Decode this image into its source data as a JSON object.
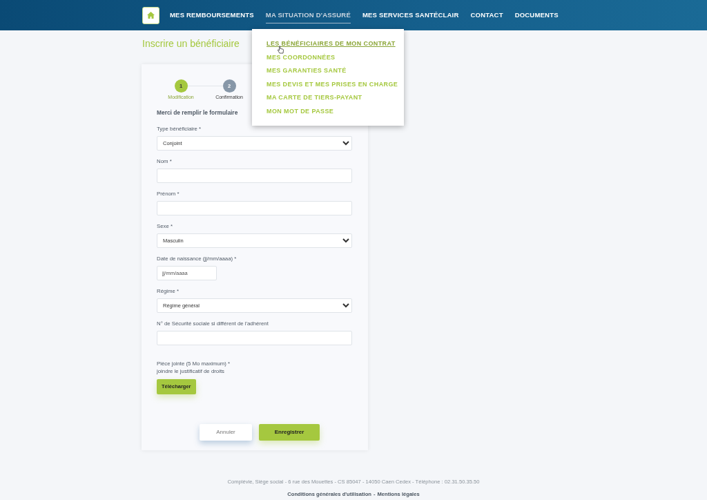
{
  "nav": {
    "items": [
      {
        "label": "MES REMBOURSEMENTS",
        "selected": false
      },
      {
        "label": "MA SITUATION D'ASSURÉ",
        "selected": true
      },
      {
        "label": "MES SERVICES SANTÉCLAIR",
        "selected": false
      },
      {
        "label": "CONTACT",
        "selected": false
      },
      {
        "label": "DOCUMENTS",
        "selected": false
      }
    ]
  },
  "dropdown": {
    "items": [
      {
        "label": "LES BÉNÉFICIAIRES DE MON CONTRAT",
        "selected": true
      },
      {
        "label": "MES COORDONNÉES",
        "selected": false
      },
      {
        "label": "MES GARANTIES SANTÉ",
        "selected": false
      },
      {
        "label": "MES DEVIS ET MES PRISES EN CHARGE",
        "selected": false
      },
      {
        "label": "MA CARTE DE TIERS-PAYANT",
        "selected": false
      },
      {
        "label": "MON MOT DE PASSE",
        "selected": false
      }
    ]
  },
  "page_title": "Inscrire un bénéficiaire",
  "stepper": [
    {
      "number": "1",
      "label": "Modification",
      "selected": true
    },
    {
      "number": "2",
      "label": "Confirmation",
      "selected": false
    }
  ],
  "form": {
    "intro": "Merci de remplir le formulaire",
    "fields": [
      {
        "kind": "select",
        "label": "Type bénéficiaire *",
        "value": "Conjoint"
      },
      {
        "kind": "text",
        "label": "Nom *"
      },
      {
        "kind": "text",
        "label": "Prénom *"
      },
      {
        "kind": "select",
        "label": "Sexe *",
        "value": "Masculin"
      },
      {
        "kind": "date",
        "label": "Date de naissance (jj/mm/aaaa) *",
        "placeholder": "jj/mm/aaaa"
      },
      {
        "kind": "select",
        "label": "Régime *",
        "value": "Régime général"
      },
      {
        "kind": "text",
        "label": "N° de Sécurité sociale si différent de l'adhérent"
      },
      {
        "kind": "file",
        "label": "Pièce jointe (5 Mo maximum) *",
        "hint": "joindre le justificatif de droits",
        "button": "Télécharger"
      }
    ],
    "buttons": [
      {
        "label": "Annuler",
        "kind": "secondary"
      },
      {
        "label": "Enregistrer",
        "kind": "primary"
      }
    ]
  },
  "footer": {
    "address": "Complévie, Siège social - 6 rue des Mouettes - CS 85047 - 14050 Caen Cedex - Téléphone : 02.31.50.35.50",
    "links": [
      {
        "label": "Conditions générales d'utilisation"
      },
      {
        "label": "Mentions légales"
      }
    ],
    "separator": "-"
  }
}
